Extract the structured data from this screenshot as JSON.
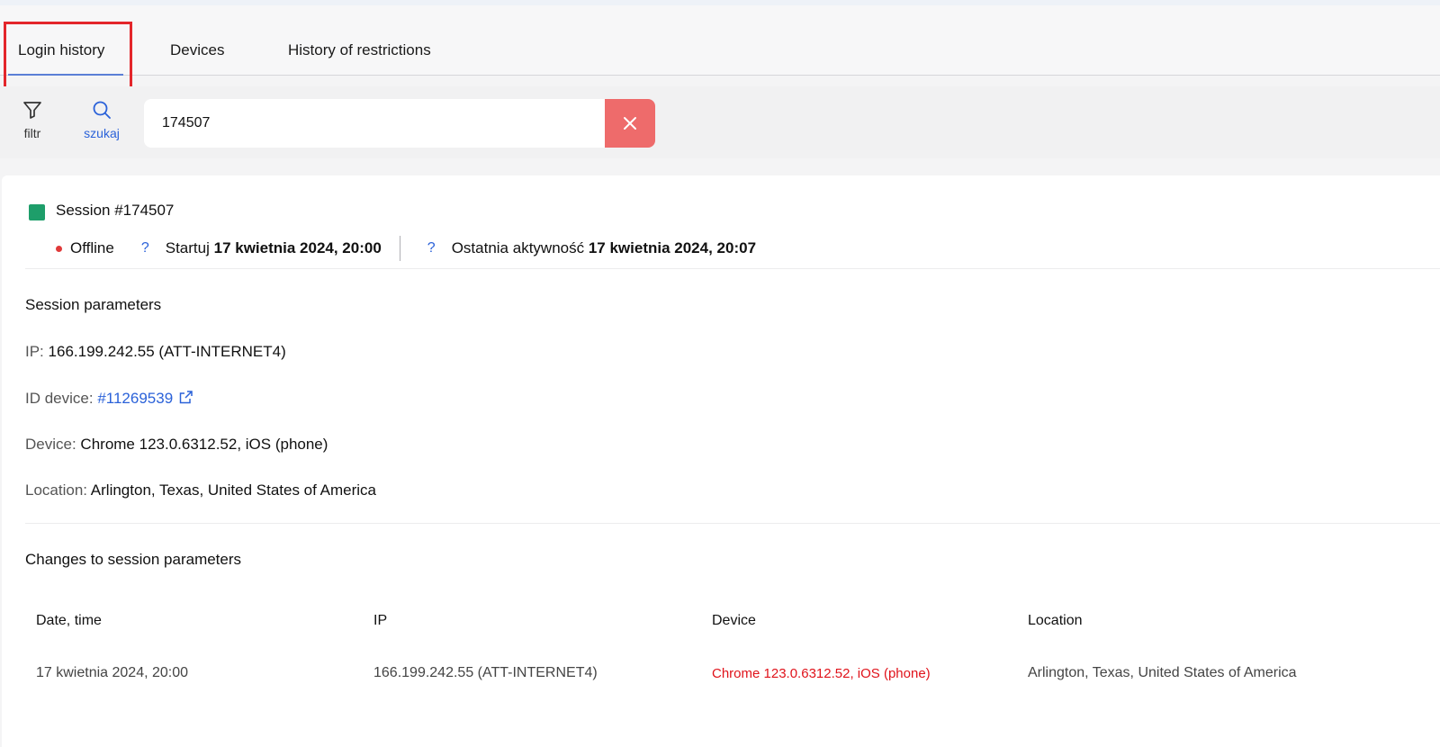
{
  "tabs": [
    {
      "label": "Login history",
      "active": true
    },
    {
      "label": "Devices",
      "active": false
    },
    {
      "label": "History of restrictions",
      "active": false
    }
  ],
  "toolbar": {
    "filter_label": "filtr",
    "search_label": "szukaj",
    "search_value": "174507"
  },
  "session": {
    "title": "Session #174507",
    "status": "Offline",
    "help_icon": "?",
    "start_label": "Startuj",
    "start_value": "17 kwietnia 2024, 20:00",
    "last_activity_label": "Ostatnia aktywność",
    "last_activity_value": "17 kwietnia 2024, 20:07"
  },
  "params": {
    "section_title": "Session parameters",
    "ip_label": "IP:",
    "ip_value": "166.199.242.55 (ATT-INTERNET4)",
    "device_id_label": "ID device:",
    "device_id_value": "#11269539",
    "device_label": "Device:",
    "device_value": "Chrome 123.0.6312.52, iOS (phone)",
    "location_label": "Location:",
    "location_value": "Arlington, Texas, United States of America"
  },
  "changes": {
    "section_title": "Changes to session parameters",
    "columns": [
      "Date, time",
      "IP",
      "Device",
      "Location"
    ],
    "rows": [
      {
        "datetime": "17 kwietnia 2024, 20:00",
        "ip": "166.199.242.55 (ATT-INTERNET4)",
        "device": "Chrome 123.0.6312.52, iOS (phone)",
        "location": "Arlington, Texas, United States of America"
      }
    ]
  },
  "colors": {
    "online_square": "#1e9e6a",
    "offline_dot": "#e03a3a",
    "clear_button": "#ee6b6b",
    "link": "#2b62d9",
    "changed_value": "#e0121a",
    "highlight_box": "#e3262b"
  },
  "icons": {
    "filter": "filter-icon",
    "search": "search-icon",
    "clear": "close-icon",
    "external_link": "external-link-icon"
  }
}
